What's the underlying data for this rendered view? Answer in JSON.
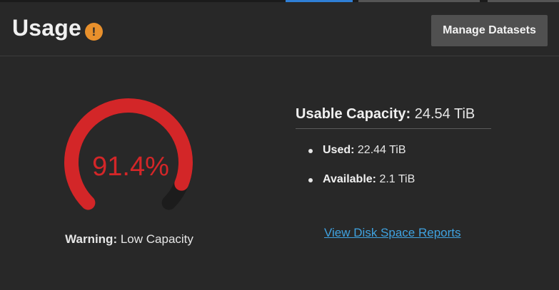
{
  "header": {
    "title": "Usage",
    "warning_icon_glyph": "!",
    "manage_button_label": "Manage Datasets"
  },
  "gauge": {
    "percent_label": "91.4%",
    "fraction_used": 0.914,
    "fill_color": "#d32628",
    "track_color": "#1c1c1c",
    "caption_prefix": "Warning:",
    "caption_text": "Low Capacity"
  },
  "capacity": {
    "label": "Usable Capacity:",
    "value": "24.54 TiB"
  },
  "stats": [
    {
      "label": "Used:",
      "value": "22.44 TiB"
    },
    {
      "label": "Available:",
      "value": "2.1 TiB"
    }
  ],
  "report_link": "View Disk Space Reports",
  "colors": {
    "background": "#282828",
    "accent_link": "#3fa2e0",
    "warning": "#e8902c"
  }
}
